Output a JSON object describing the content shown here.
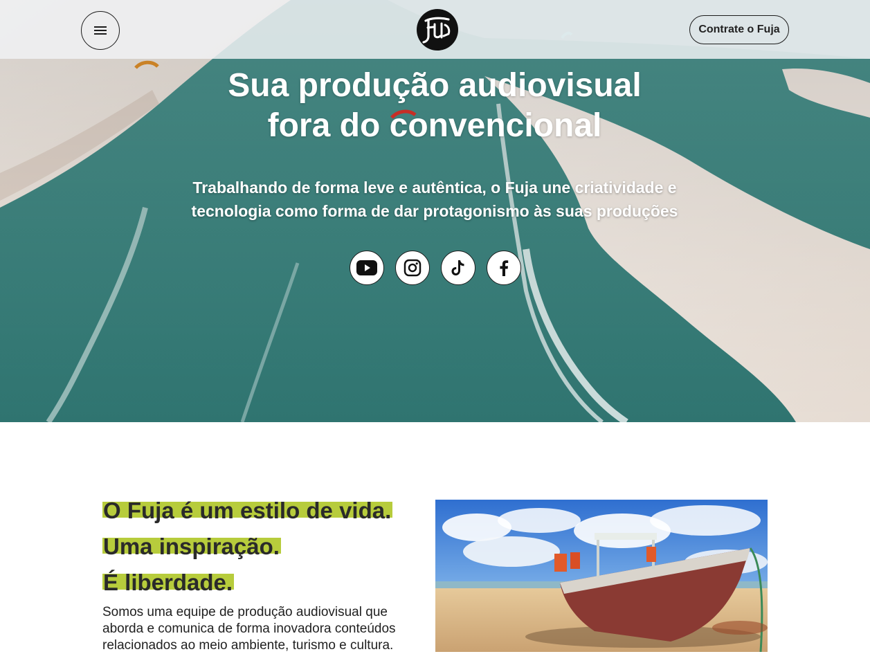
{
  "header": {
    "menu_label": "Menu",
    "cta_label": "Contrate o Fuja"
  },
  "hero": {
    "title_lines": [
      "Sua produção audiovisual",
      "fora do convencional"
    ],
    "subtitle_lines": [
      "Trabalhando de forma leve e autêntica, o Fuja une criatividade e",
      "tecnologia como forma de dar protagonismo às suas produções"
    ],
    "socials": [
      {
        "name": "youtube",
        "icon": "youtube-icon"
      },
      {
        "name": "instagram",
        "icon": "instagram-icon"
      },
      {
        "name": "tiktok",
        "icon": "tiktok-icon"
      },
      {
        "name": "facebook",
        "icon": "facebook-icon"
      }
    ]
  },
  "about": {
    "heading_lines": [
      "O Fuja é um estilo de vida.",
      "Uma inspiração.",
      "É liberdade."
    ],
    "body_lines": [
      "Somos uma equipe de produção audiovisual que",
      "aborda e comunica de forma inovadora conteúdos",
      "relacionados ao meio ambiente, turismo e cultura."
    ]
  },
  "colors": {
    "highlight": "#b7cc3c",
    "text_dark": "#2a2a2a",
    "header_bg": "#eceef0",
    "sea": "#3f8a84",
    "sand": "#eee6df"
  }
}
